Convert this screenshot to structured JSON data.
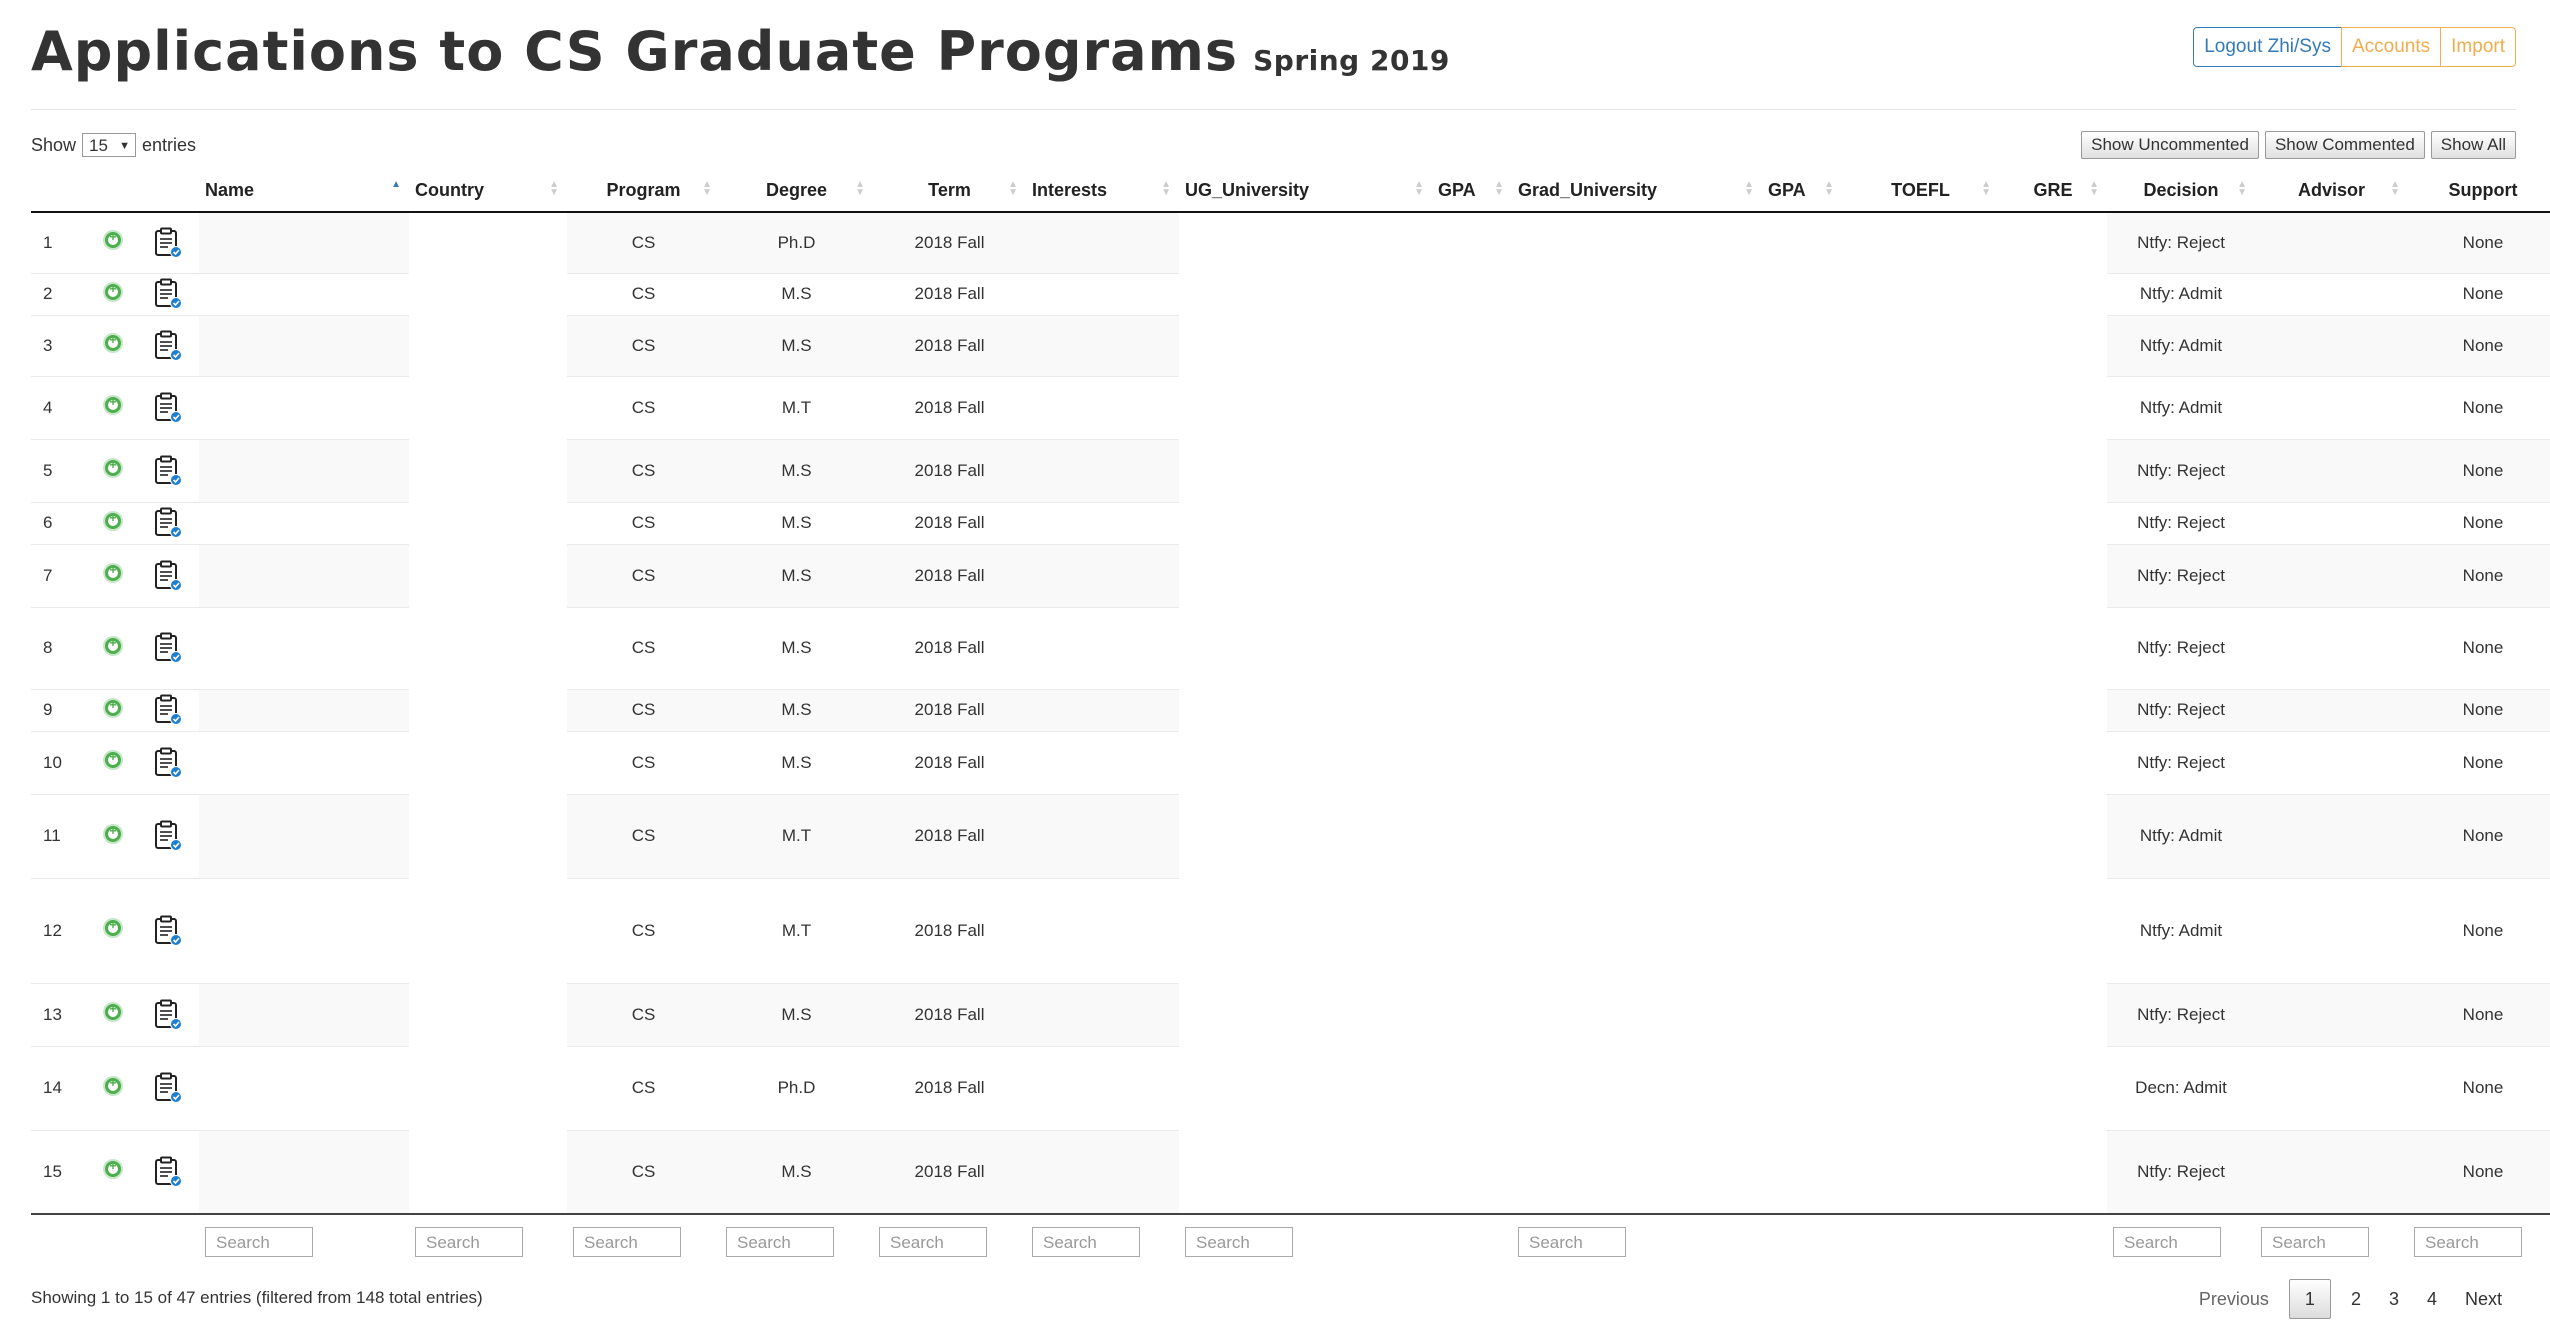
{
  "header": {
    "title": "Applications to CS Graduate Programs",
    "subtitle": "Spring 2019",
    "buttons": {
      "logout": "Logout Zhi/Sys",
      "accounts": "Accounts",
      "import": "Import"
    }
  },
  "length": {
    "prefix": "Show",
    "value": "15",
    "suffix": "entries"
  },
  "filters": {
    "uncommented": "Show Uncommented",
    "commented": "Show Commented",
    "all": "Show All"
  },
  "columns": {
    "name": "Name",
    "country": "Country",
    "program": "Program",
    "degree": "Degree",
    "term": "Term",
    "interests": "Interests",
    "ug_university": "UG_University",
    "gpa1": "GPA",
    "grad_university": "Grad_University",
    "gpa2": "GPA",
    "toefl": "TOEFL",
    "gre": "GRE",
    "decision": "Decision",
    "advisor": "Advisor",
    "support": "Support"
  },
  "rows": [
    {
      "n": "1",
      "program": "CS",
      "degree": "Ph.D",
      "term": "2018 Fall",
      "decision": "Ntfy: Reject",
      "support": "None"
    },
    {
      "n": "2",
      "program": "CS",
      "degree": "M.S",
      "term": "2018 Fall",
      "decision": "Ntfy: Admit",
      "support": "None"
    },
    {
      "n": "3",
      "program": "CS",
      "degree": "M.S",
      "term": "2018 Fall",
      "decision": "Ntfy: Admit",
      "support": "None"
    },
    {
      "n": "4",
      "program": "CS",
      "degree": "M.T",
      "term": "2018 Fall",
      "decision": "Ntfy: Admit",
      "support": "None"
    },
    {
      "n": "5",
      "program": "CS",
      "degree": "M.S",
      "term": "2018 Fall",
      "decision": "Ntfy: Reject",
      "support": "None"
    },
    {
      "n": "6",
      "program": "CS",
      "degree": "M.S",
      "term": "2018 Fall",
      "decision": "Ntfy: Reject",
      "support": "None"
    },
    {
      "n": "7",
      "program": "CS",
      "degree": "M.S",
      "term": "2018 Fall",
      "decision": "Ntfy: Reject",
      "support": "None"
    },
    {
      "n": "8",
      "program": "CS",
      "degree": "M.S",
      "term": "2018 Fall",
      "decision": "Ntfy: Reject",
      "support": "None"
    },
    {
      "n": "9",
      "program": "CS",
      "degree": "M.S",
      "term": "2018 Fall",
      "decision": "Ntfy: Reject",
      "support": "None"
    },
    {
      "n": "10",
      "program": "CS",
      "degree": "M.S",
      "term": "2018 Fall",
      "decision": "Ntfy: Reject",
      "support": "None"
    },
    {
      "n": "11",
      "program": "CS",
      "degree": "M.T",
      "term": "2018 Fall",
      "decision": "Ntfy: Admit",
      "support": "None"
    },
    {
      "n": "12",
      "program": "CS",
      "degree": "M.T",
      "term": "2018 Fall",
      "decision": "Ntfy: Admit",
      "support": "None"
    },
    {
      "n": "13",
      "program": "CS",
      "degree": "M.S",
      "term": "2018 Fall",
      "decision": "Ntfy: Reject",
      "support": "None"
    },
    {
      "n": "14",
      "program": "CS",
      "degree": "Ph.D",
      "term": "2018 Fall",
      "decision": "Decn: Admit",
      "support": "None"
    },
    {
      "n": "15",
      "program": "CS",
      "degree": "M.S",
      "term": "2018 Fall",
      "decision": "Ntfy: Reject",
      "support": "None"
    }
  ],
  "search": {
    "placeholder": "Search"
  },
  "info": "Showing 1 to 15 of 47 entries (filtered from 148 total entries)",
  "pager": {
    "previous": "Previous",
    "pages": [
      "1",
      "2",
      "3",
      "4"
    ],
    "next": "Next"
  }
}
